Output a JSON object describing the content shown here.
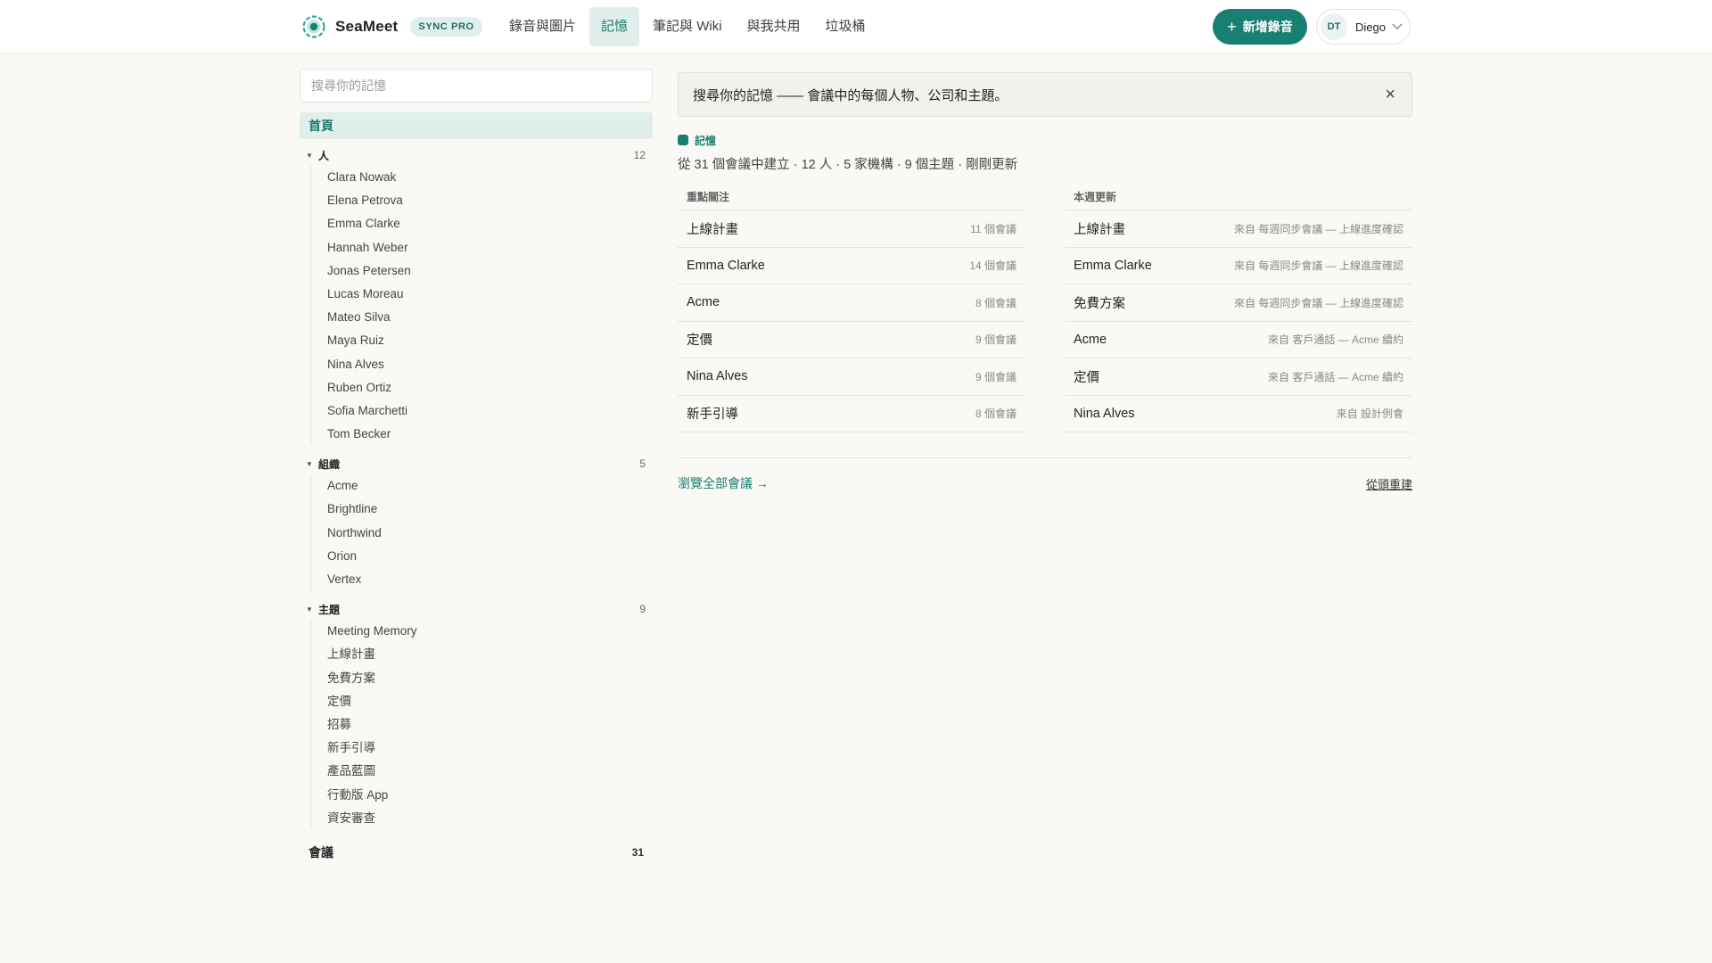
{
  "header": {
    "brand": "SeaMeet",
    "plan_badge": "SYNC PRO",
    "tabs": [
      {
        "label": "錄音與圖片"
      },
      {
        "label": "記憶"
      },
      {
        "label": "筆記與 Wiki"
      },
      {
        "label": "與我共用"
      },
      {
        "label": "垃圾桶"
      }
    ],
    "active_tab": "記憶",
    "new_recording_label": "新增錄音",
    "user": {
      "initials": "DT",
      "name": "Diego"
    }
  },
  "sidebar": {
    "search_placeholder": "搜尋你的記憶",
    "home_label": "首頁",
    "groups": [
      {
        "label": "人",
        "count": "12",
        "items": [
          "Clara Nowak",
          "Elena Petrova",
          "Emma Clarke",
          "Hannah Weber",
          "Jonas Petersen",
          "Lucas Moreau",
          "Mateo Silva",
          "Maya Ruiz",
          "Nina Alves",
          "Ruben Ortiz",
          "Sofia Marchetti",
          "Tom Becker"
        ]
      },
      {
        "label": "組織",
        "count": "5",
        "items": [
          "Acme",
          "Brightline",
          "Northwind",
          "Orion",
          "Vertex"
        ]
      },
      {
        "label": "主題",
        "count": "9",
        "items": [
          "Meeting Memory",
          "上線計畫",
          "免費方案",
          "定價",
          "招募",
          "新手引導",
          "產品藍圖",
          "行動版 App",
          "資安審查"
        ]
      }
    ],
    "meetings": {
      "label": "會議",
      "count": "31"
    }
  },
  "main": {
    "banner": {
      "text": "搜尋你的記憶 —— 會議中的每個人物、公司和主題。",
      "close": "×"
    },
    "memory_label": "記憶",
    "stats": "從 31 個會議中建立 · 12 人 · 5 家機構 · 9 個主題 · 剛剛更新",
    "featured": {
      "heading": "重點關注",
      "rows": [
        {
          "title": "上線計畫",
          "meta": "11 個會議"
        },
        {
          "title": "Emma Clarke",
          "meta": "14 個會議"
        },
        {
          "title": "Acme",
          "meta": "8 個會議"
        },
        {
          "title": "定價",
          "meta": "9 個會議"
        },
        {
          "title": "Nina Alves",
          "meta": "9 個會議"
        },
        {
          "title": "新手引導",
          "meta": "8 個會議"
        }
      ]
    },
    "updates": {
      "heading": "本週更新",
      "rows": [
        {
          "title": "上線計畫",
          "meta": "來自 每週同步會議 — 上線進度確認"
        },
        {
          "title": "Emma Clarke",
          "meta": "來自 每週同步會議 — 上線進度確認"
        },
        {
          "title": "免費方案",
          "meta": "來自 每週同步會議 — 上線進度確認"
        },
        {
          "title": "Acme",
          "meta": "來自 客戶通話 — Acme 續約"
        },
        {
          "title": "定價",
          "meta": "來自 客戶通話 — Acme 續約"
        },
        {
          "title": "Nina Alves",
          "meta": "來自 設計例會"
        }
      ]
    },
    "browse_all": "瀏覽全部會議 →",
    "rebuild": "從頭重建"
  },
  "colors": {
    "accent": "#178073",
    "accent_soft": "#e1efec",
    "background": "#faf9f6"
  }
}
